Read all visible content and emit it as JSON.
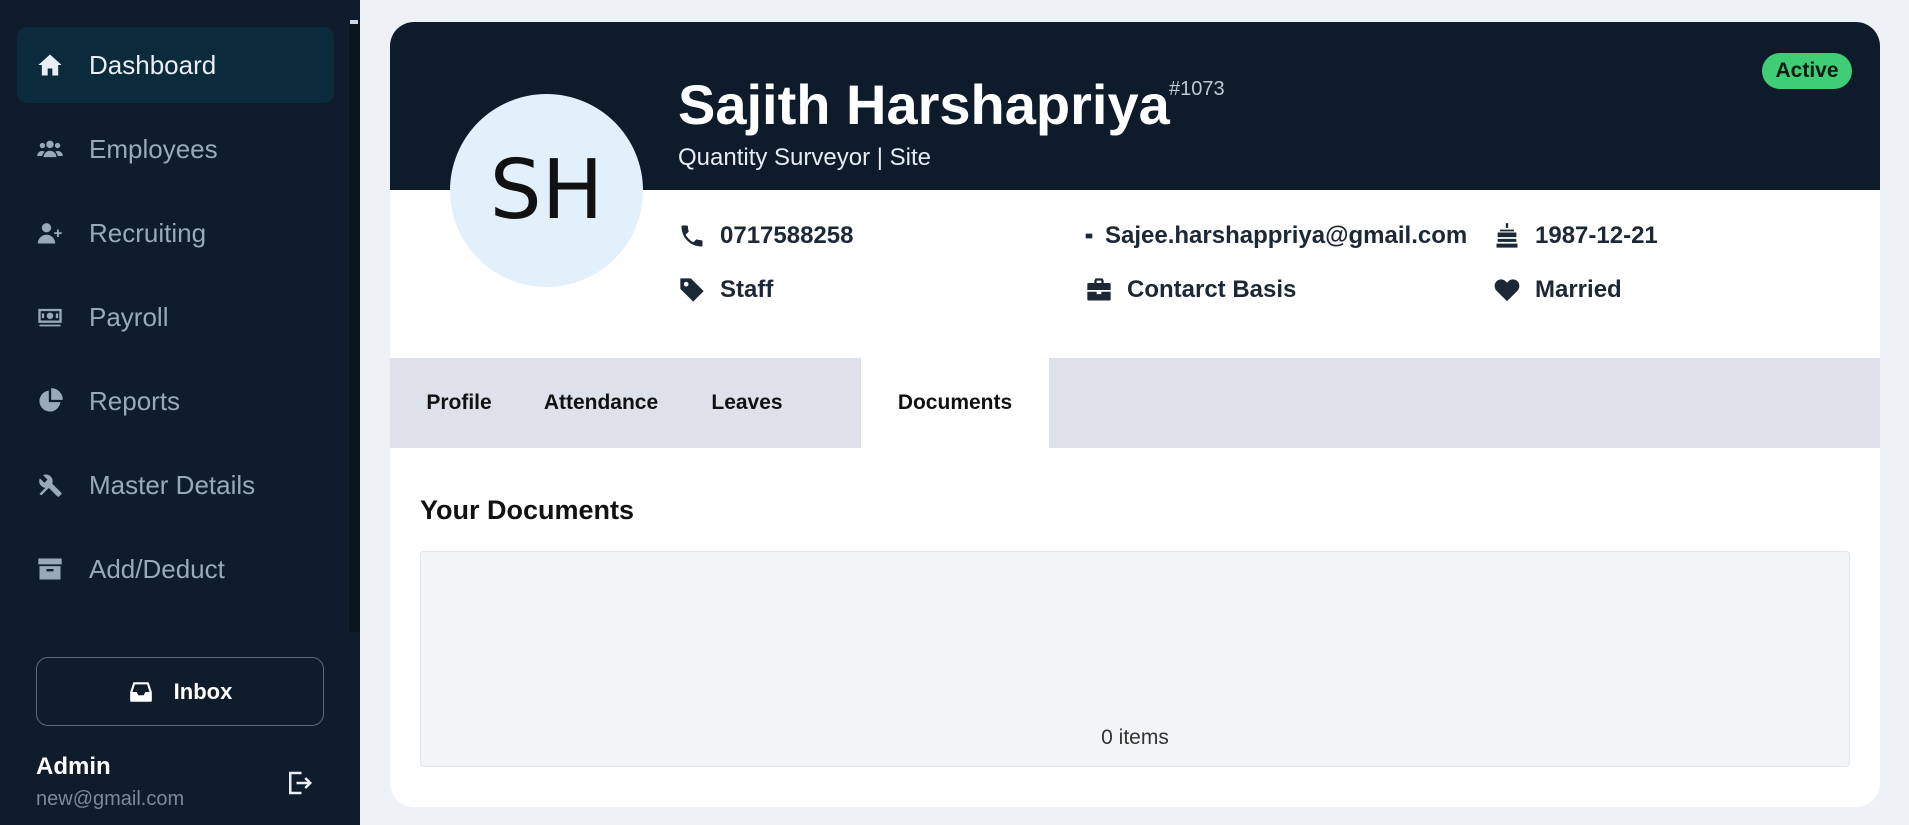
{
  "sidebar": {
    "items": [
      {
        "label": "Dashboard",
        "icon": "home-icon",
        "active": true
      },
      {
        "label": "Employees",
        "icon": "users-icon",
        "active": false
      },
      {
        "label": "Recruiting",
        "icon": "user-plus-icon",
        "active": false
      },
      {
        "label": "Payroll",
        "icon": "money-bill-icon",
        "active": false
      },
      {
        "label": "Reports",
        "icon": "pie-chart-icon",
        "active": false
      },
      {
        "label": "Master Details",
        "icon": "tools-icon",
        "active": false
      },
      {
        "label": "Add/Deduct",
        "icon": "archive-icon",
        "active": false
      }
    ],
    "inbox_label": "Inbox",
    "user": {
      "name": "Admin",
      "email": "new@gmail.com"
    }
  },
  "employee": {
    "initials": "SH",
    "name": "Sajith Harshapriya",
    "id": "#1073",
    "title": "Quantity Surveyor | Site",
    "status": "Active",
    "phone": "0717588258",
    "email": "Sajee.harshappriya@gmail.com",
    "birthday": "1987-12-21",
    "category": "Staff",
    "employment_type": "Contarct Basis",
    "marital_status": "Married"
  },
  "tabs": [
    {
      "label": "Profile",
      "active": false
    },
    {
      "label": "Attendance",
      "active": false
    },
    {
      "label": "Leaves",
      "active": false
    },
    {
      "label": "Documents",
      "active": true
    }
  ],
  "documents": {
    "title": "Your Documents",
    "count_text": "0 items"
  },
  "colors": {
    "sidebar_bg": "#0f1c2b",
    "banner_bg": "#0e1b2b",
    "status_green": "#3fce76",
    "avatar_bg": "#e2f0fb"
  }
}
